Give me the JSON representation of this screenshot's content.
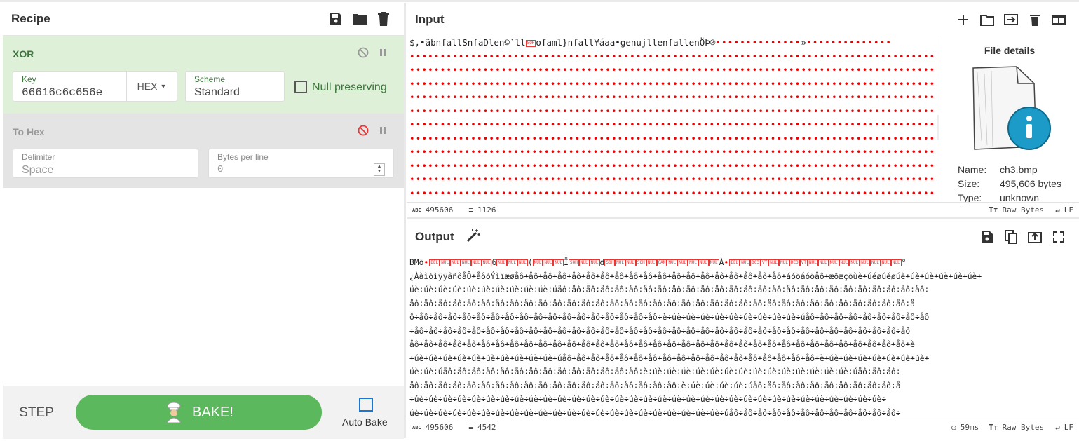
{
  "recipe": {
    "title": "Recipe",
    "save_icon": "save-icon",
    "folder_icon": "folder-icon",
    "trash_icon": "trash-icon",
    "operations": [
      {
        "name": "XOR",
        "key_label": "Key",
        "key_value": "66616c6c656e",
        "key_format": "HEX",
        "scheme_label": "Scheme",
        "scheme_value": "Standard",
        "null_preserving_label": "Null preserving"
      },
      {
        "name": "To Hex",
        "delimiter_label": "Delimiter",
        "delimiter_value": "Space",
        "bytes_per_line_label": "Bytes per line",
        "bytes_per_line_value": "0"
      }
    ],
    "step_label": "STEP",
    "bake_label": "BAKE!",
    "auto_bake_label": "Auto Bake"
  },
  "input": {
    "title": "Input",
    "first_line": "$,•ãbnfallSnfaDlen©`ll",
    "first_line_b": "ofaml}nfall¥áaa•genujllenfallenÖÞ®",
    "first_line_c": "»",
    "status_length": "495606",
    "status_lines": "1126",
    "raw_bytes_label": "Raw Bytes",
    "eol_label": "LF"
  },
  "file_details": {
    "title": "File details",
    "name_label": "Name:",
    "name_value": "ch3.bmp",
    "size_label": "Size:",
    "size_value": "495,606 bytes",
    "type_label": "Type:",
    "type_value": "unknown"
  },
  "output": {
    "title": "Output",
    "first_line_a": "BMö",
    "first_line_b": "6",
    "first_line_c": "(",
    "first_line_d": "Ï",
    "first_line_e": "d",
    "first_line_f": "À",
    "first_line_g": "°",
    "line2": "¿ÀàìòìÿÿâñôåÔ÷åôõÝìïæøåô÷åô÷åô÷åô÷åô÷åô÷åô÷åô÷åô÷åô÷åô÷åô÷åô÷åô÷åô÷åô÷åô÷åô÷åô÷áóöáóöåô÷æõæçöùè÷úéøúéøúè÷úè÷úè÷úè÷úè÷úè÷",
    "line3": "úè÷úè÷úè÷úè÷úè÷úè÷úè÷úè÷úè÷úè÷úåô÷åô÷åô÷åô÷åô÷åô÷åô÷åô÷åô÷åô÷åô÷åô÷åô÷åô÷åô÷åô÷åô÷åô÷åô÷åô÷åô÷åô÷åô÷åô÷åô÷åô÷",
    "line4": "åô÷åô÷åô÷åô÷åô÷åô÷åô÷åô÷åô÷åô÷åô÷åô÷åô÷åô÷åô÷åô÷åô÷åô÷åô÷åô÷åô÷åô÷åô÷åô÷åô÷åô÷åô÷åô÷åô÷åô÷åô÷åô÷åô÷åô÷åô÷å",
    "line5": "ô÷åô÷åô÷åô÷åô÷åô÷åô÷åô÷åô÷åô÷åô÷åô÷åô÷åô÷åô÷åô÷åô÷åô÷è÷úè÷úè÷úè÷úè÷úè÷úè÷úè÷úè÷úè÷úåô÷åô÷åô÷åô÷åô÷åô÷åô÷åô÷åô",
    "line6": "÷åô÷åô÷åô÷åô÷åô÷åô÷åô÷åô÷åô÷åô÷åô÷åô÷åô÷åô÷åô÷åô÷åô÷åô÷åô÷åô÷åô÷åô÷åô÷åô÷åô÷åô÷åô÷åô÷åô÷åô÷åô÷åô÷åô÷åô÷åô",
    "line7": "åô÷åô÷åô÷åô÷åô÷åô÷åô÷åô÷åô÷åô÷åô÷åô÷åô÷åô÷åô÷åô÷åô÷åô÷åô÷åô÷åô÷åô÷åô÷åô÷åô÷åô÷åô÷åô÷åô÷åô÷åô÷åô÷åô÷åô÷åô÷è",
    "line8": "÷úè÷úè÷úè÷úè÷úè÷úè÷úè÷úè÷úè÷úè÷úåô÷åô÷åô÷åô÷åô÷åô÷åô÷åô÷åô÷åô÷åô÷åô÷åô÷åô÷åô÷åô÷åô÷åô÷è÷úè÷úè÷úè÷úè÷úè÷úè÷úè÷",
    "line9": "úè÷úè÷úåô÷åô÷åô÷åô÷åô÷åô÷åô÷åô÷åô÷åô÷åô÷åô÷åô÷åô÷è÷úè÷úè÷úè÷úè÷úè÷úè÷úè÷úè÷úè÷úè÷úè÷úè÷úè÷úè÷úåô÷åô÷åô÷",
    "line10": "åô÷åô÷åô÷åô÷åô÷åô÷åô÷åô÷åô÷åô÷åô÷åô÷åô÷åô÷åô÷åô÷åô÷åô÷åô÷è÷úè÷úè÷úè÷úè÷úåô÷åô÷åô÷åô÷åô÷åô÷åô÷åô÷åô÷åô÷å",
    "line11": "÷úè÷úè÷úè÷úè÷úè÷úè÷úè÷úè÷úè÷úè÷úè÷úè÷úè÷úè÷úè÷úè÷úè÷úè÷úè÷úè÷úè÷úè÷úè÷úè÷úè÷úè÷úè÷úè÷úè÷úè÷úè÷úè÷úè÷",
    "line12": "úè÷úè÷úè÷úè÷úè÷úè÷úè÷úè÷úè÷úè÷úè÷úè÷úè÷úè÷úè÷úè÷úè÷úè÷úè÷úè÷úè÷úè÷úåô÷åô÷åô÷åô÷åô÷åô÷åô÷åô÷åô÷åô÷åô÷åô÷",
    "status_length": "495606",
    "status_lines": "4542",
    "time": "59ms",
    "raw_bytes_label": "Raw Bytes",
    "eol_label": "LF"
  },
  "colors": {
    "xor_bg": "#dff0d8",
    "bake": "#5cb85c",
    "disabled_op": "#e4e4e4",
    "dots": "#e00000"
  }
}
